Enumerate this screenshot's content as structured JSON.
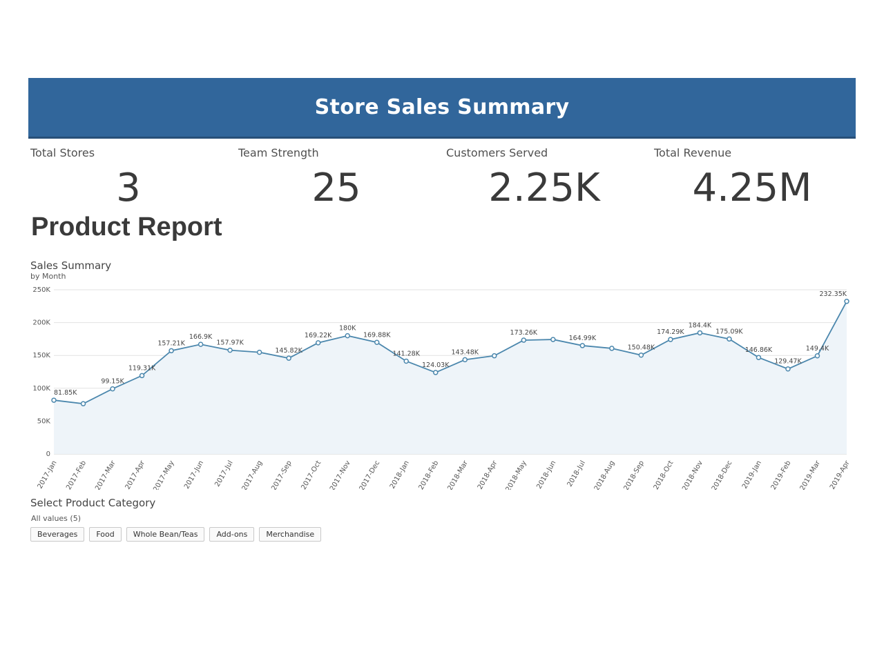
{
  "header": {
    "title": "Store Sales Summary"
  },
  "kpis": [
    {
      "label": "Total Stores",
      "value": "3"
    },
    {
      "label": "Team Strength",
      "value": "25"
    },
    {
      "label": "Customers Served",
      "value": "2.25K"
    },
    {
      "label": "Total Revenue",
      "value": "4.25M"
    }
  ],
  "product_report": {
    "title": "Product Report"
  },
  "chart_data": {
    "type": "area",
    "title": "Sales Summary",
    "subtitle": "by Month",
    "xlabel": "",
    "ylabel": "",
    "ylim": [
      0,
      250000
    ],
    "yticks": [
      {
        "value": 0,
        "label": "0"
      },
      {
        "value": 50000,
        "label": "50K"
      },
      {
        "value": 100000,
        "label": "100K"
      },
      {
        "value": 150000,
        "label": "150K"
      },
      {
        "value": 200000,
        "label": "200K"
      },
      {
        "value": 250000,
        "label": "250K"
      }
    ],
    "grid": true,
    "line_color": "#4b87ad",
    "fill_color": "#eef4f9",
    "categories": [
      "2017-Jan",
      "2017-Feb",
      "2017-Mar",
      "2017-Apr",
      "2017-May",
      "2017-Jun",
      "2017-Jul",
      "2017-Aug",
      "2017-Sep",
      "2017-Oct",
      "2017-Nov",
      "2017-Dec",
      "2018-Jan",
      "2018-Feb",
      "2018-Mar",
      "2018-Apr",
      "2018-May",
      "2018-Jun",
      "2018-Jul",
      "2018-Aug",
      "2018-Sep",
      "2018-Oct",
      "2018-Nov",
      "2018-Dec",
      "2019-Jan",
      "2019-Feb",
      "2019-Mar",
      "2019-Apr"
    ],
    "values": [
      81850,
      76500,
      99150,
      119310,
      157210,
      166900,
      157970,
      154800,
      145820,
      169220,
      180000,
      169880,
      141280,
      124030,
      143480,
      149500,
      173260,
      174300,
      164990,
      160800,
      150480,
      174290,
      184400,
      175090,
      146860,
      129470,
      149400,
      232350
    ],
    "data_labels": [
      "81.85K",
      "",
      "99.15K",
      "119.31K",
      "157.21K",
      "166.9K",
      "157.97K",
      "",
      "145.82K",
      "169.22K",
      "180K",
      "169.88K",
      "141.28K",
      "124.03K",
      "143.48K",
      "",
      "173.26K",
      "",
      "164.99K",
      "",
      "150.48K",
      "174.29K",
      "184.4K",
      "175.09K",
      "146.86K",
      "129.47K",
      "149.4K",
      "232.35K"
    ]
  },
  "filter": {
    "title": "Select Product Category",
    "subtitle": "All values (5)",
    "options": [
      "Beverages",
      "Food",
      "Whole Bean/Teas",
      "Add-ons",
      "Merchandise"
    ]
  }
}
